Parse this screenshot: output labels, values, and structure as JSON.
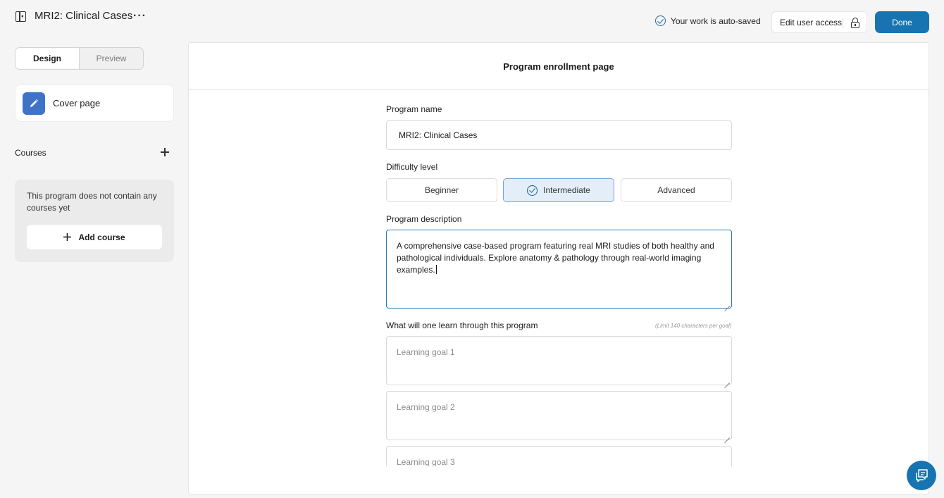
{
  "header": {
    "program_title": "MRI2: Clinical Cases",
    "more_menu": "···",
    "autosave_text": "Your work is auto-saved",
    "edit_access_label": "Edit user access",
    "done_label": "Done"
  },
  "sidebar": {
    "tabs": [
      {
        "label": "Design",
        "active": true
      },
      {
        "label": "Preview",
        "active": false
      }
    ],
    "cover_page_label": "Cover page",
    "courses_label": "Courses",
    "empty_message": "This program does not contain any courses yet",
    "add_course_label": "Add course"
  },
  "main": {
    "card_title": "Program enrollment page",
    "program_name_label": "Program name",
    "program_name_value": "MRI2: Clinical Cases",
    "difficulty_label": "Difficulty level",
    "difficulty_options": [
      {
        "label": "Beginner",
        "selected": false
      },
      {
        "label": "Intermediate",
        "selected": true
      },
      {
        "label": "Advanced",
        "selected": false
      }
    ],
    "description_label": "Program description",
    "description_value": "A comprehensive case-based program featuring real MRI studies of both healthy and pathological individuals. Explore anatomy & pathology through real-world imaging examples.",
    "learn_label": "What will one learn through this program",
    "learn_hint": "(Limit 140 characters per goal)",
    "goals": [
      {
        "placeholder": "Learning goal 1"
      },
      {
        "placeholder": "Learning goal 2"
      },
      {
        "placeholder": "Learning goal 3"
      }
    ]
  },
  "colors": {
    "accent": "#1774b0",
    "selected_fill": "#e3eef8",
    "page_background": "#f5f5f5",
    "pencil_tile": "#3f73c7"
  },
  "icons": [
    "sidebar-toggle-icon",
    "more-horizontal-icon",
    "check-circle-icon",
    "lock-icon",
    "pencil-icon",
    "plus-icon",
    "chat-icon"
  ]
}
